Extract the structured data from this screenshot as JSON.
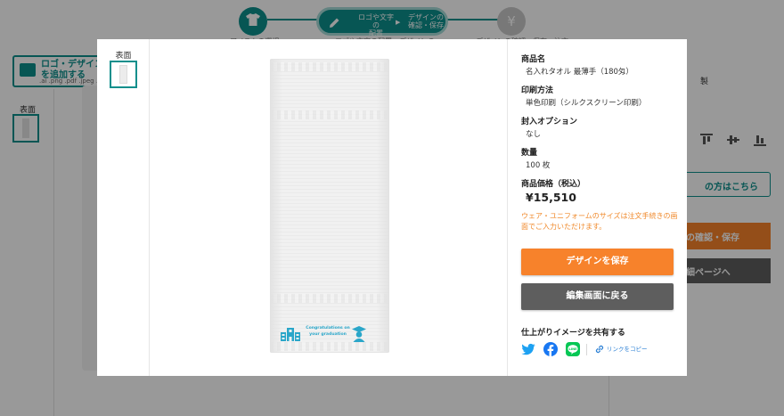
{
  "stepbar": {
    "step2": {
      "line1": "ロゴや文字の",
      "line2": "配置",
      "next1": "デザインの",
      "next2": "確認・保存",
      "arrow": "▶"
    },
    "step1_label": "アイテムの選択",
    "step2_label": "ロゴや文字の配置・デザインの",
    "step3_label": "デザインの確認・保存・注文",
    "step3_icon": "¥"
  },
  "background": {
    "upload_button": "ロゴ・デザインを追加する",
    "upload_hint": ".ai .png .pdf .jpeg .psd /",
    "face_label": "表面",
    "right_text": "製",
    "ghost_button": "の方はこちら",
    "orange_button": "の確認・保存",
    "dark_button": "細ページへ"
  },
  "modal": {
    "face_label": "表面",
    "print_text_line1": "Congratulations on",
    "print_text_line2": "your graduation",
    "product": {
      "label": "商品名",
      "value": "名入れタオル 最薄手（180匁）"
    },
    "print_method": {
      "label": "印刷方法",
      "value": "単色印刷（シルクスクリーン印刷）"
    },
    "packaging": {
      "label": "封入オプション",
      "value": "なし"
    },
    "quantity": {
      "label": "数量",
      "value": "100 枚"
    },
    "price": {
      "label": "商品価格（税込）",
      "value": "¥15,510"
    },
    "notice": "ウェア・ユニフォームのサイズは注文手続きの画面でご入力いただけます。",
    "save_button": "デザインを保存",
    "back_button": "編集画面に戻る",
    "share": {
      "title": "仕上がりイメージを共有する",
      "copy_link": "リンクをコピー",
      "icons": [
        "twitter-icon",
        "facebook-icon",
        "line-icon",
        "link-icon"
      ]
    }
  },
  "colors": {
    "accent": "#0d8f8c",
    "orange": "#f7822b",
    "dark_button": "#5e5e5e",
    "notice_text": "#f08a2c",
    "print_blue": "#2aa6c9",
    "twitter": "#1da1f2",
    "facebook": "#1877f2",
    "line": "#06c755",
    "link": "#2a7fd4"
  }
}
